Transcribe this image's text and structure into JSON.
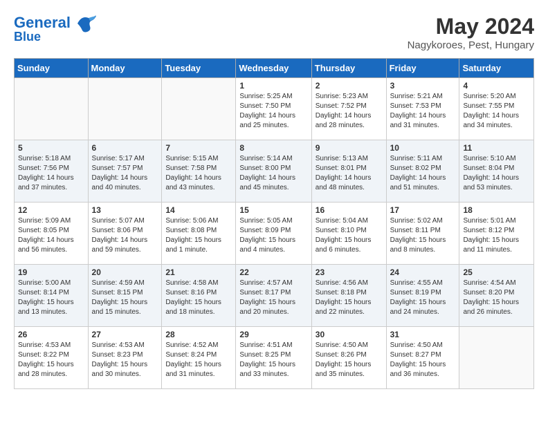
{
  "header": {
    "logo_line1": "General",
    "logo_line2": "Blue",
    "month_title": "May 2024",
    "location": "Nagykoroes, Pest, Hungary"
  },
  "weekdays": [
    "Sunday",
    "Monday",
    "Tuesday",
    "Wednesday",
    "Thursday",
    "Friday",
    "Saturday"
  ],
  "weeks": [
    [
      {
        "day": "",
        "info": ""
      },
      {
        "day": "",
        "info": ""
      },
      {
        "day": "",
        "info": ""
      },
      {
        "day": "1",
        "info": "Sunrise: 5:25 AM\nSunset: 7:50 PM\nDaylight: 14 hours\nand 25 minutes."
      },
      {
        "day": "2",
        "info": "Sunrise: 5:23 AM\nSunset: 7:52 PM\nDaylight: 14 hours\nand 28 minutes."
      },
      {
        "day": "3",
        "info": "Sunrise: 5:21 AM\nSunset: 7:53 PM\nDaylight: 14 hours\nand 31 minutes."
      },
      {
        "day": "4",
        "info": "Sunrise: 5:20 AM\nSunset: 7:55 PM\nDaylight: 14 hours\nand 34 minutes."
      }
    ],
    [
      {
        "day": "5",
        "info": "Sunrise: 5:18 AM\nSunset: 7:56 PM\nDaylight: 14 hours\nand 37 minutes."
      },
      {
        "day": "6",
        "info": "Sunrise: 5:17 AM\nSunset: 7:57 PM\nDaylight: 14 hours\nand 40 minutes."
      },
      {
        "day": "7",
        "info": "Sunrise: 5:15 AM\nSunset: 7:58 PM\nDaylight: 14 hours\nand 43 minutes."
      },
      {
        "day": "8",
        "info": "Sunrise: 5:14 AM\nSunset: 8:00 PM\nDaylight: 14 hours\nand 45 minutes."
      },
      {
        "day": "9",
        "info": "Sunrise: 5:13 AM\nSunset: 8:01 PM\nDaylight: 14 hours\nand 48 minutes."
      },
      {
        "day": "10",
        "info": "Sunrise: 5:11 AM\nSunset: 8:02 PM\nDaylight: 14 hours\nand 51 minutes."
      },
      {
        "day": "11",
        "info": "Sunrise: 5:10 AM\nSunset: 8:04 PM\nDaylight: 14 hours\nand 53 minutes."
      }
    ],
    [
      {
        "day": "12",
        "info": "Sunrise: 5:09 AM\nSunset: 8:05 PM\nDaylight: 14 hours\nand 56 minutes."
      },
      {
        "day": "13",
        "info": "Sunrise: 5:07 AM\nSunset: 8:06 PM\nDaylight: 14 hours\nand 59 minutes."
      },
      {
        "day": "14",
        "info": "Sunrise: 5:06 AM\nSunset: 8:08 PM\nDaylight: 15 hours\nand 1 minute."
      },
      {
        "day": "15",
        "info": "Sunrise: 5:05 AM\nSunset: 8:09 PM\nDaylight: 15 hours\nand 4 minutes."
      },
      {
        "day": "16",
        "info": "Sunrise: 5:04 AM\nSunset: 8:10 PM\nDaylight: 15 hours\nand 6 minutes."
      },
      {
        "day": "17",
        "info": "Sunrise: 5:02 AM\nSunset: 8:11 PM\nDaylight: 15 hours\nand 8 minutes."
      },
      {
        "day": "18",
        "info": "Sunrise: 5:01 AM\nSunset: 8:12 PM\nDaylight: 15 hours\nand 11 minutes."
      }
    ],
    [
      {
        "day": "19",
        "info": "Sunrise: 5:00 AM\nSunset: 8:14 PM\nDaylight: 15 hours\nand 13 minutes."
      },
      {
        "day": "20",
        "info": "Sunrise: 4:59 AM\nSunset: 8:15 PM\nDaylight: 15 hours\nand 15 minutes."
      },
      {
        "day": "21",
        "info": "Sunrise: 4:58 AM\nSunset: 8:16 PM\nDaylight: 15 hours\nand 18 minutes."
      },
      {
        "day": "22",
        "info": "Sunrise: 4:57 AM\nSunset: 8:17 PM\nDaylight: 15 hours\nand 20 minutes."
      },
      {
        "day": "23",
        "info": "Sunrise: 4:56 AM\nSunset: 8:18 PM\nDaylight: 15 hours\nand 22 minutes."
      },
      {
        "day": "24",
        "info": "Sunrise: 4:55 AM\nSunset: 8:19 PM\nDaylight: 15 hours\nand 24 minutes."
      },
      {
        "day": "25",
        "info": "Sunrise: 4:54 AM\nSunset: 8:20 PM\nDaylight: 15 hours\nand 26 minutes."
      }
    ],
    [
      {
        "day": "26",
        "info": "Sunrise: 4:53 AM\nSunset: 8:22 PM\nDaylight: 15 hours\nand 28 minutes."
      },
      {
        "day": "27",
        "info": "Sunrise: 4:53 AM\nSunset: 8:23 PM\nDaylight: 15 hours\nand 30 minutes."
      },
      {
        "day": "28",
        "info": "Sunrise: 4:52 AM\nSunset: 8:24 PM\nDaylight: 15 hours\nand 31 minutes."
      },
      {
        "day": "29",
        "info": "Sunrise: 4:51 AM\nSunset: 8:25 PM\nDaylight: 15 hours\nand 33 minutes."
      },
      {
        "day": "30",
        "info": "Sunrise: 4:50 AM\nSunset: 8:26 PM\nDaylight: 15 hours\nand 35 minutes."
      },
      {
        "day": "31",
        "info": "Sunrise: 4:50 AM\nSunset: 8:27 PM\nDaylight: 15 hours\nand 36 minutes."
      },
      {
        "day": "",
        "info": ""
      }
    ]
  ]
}
